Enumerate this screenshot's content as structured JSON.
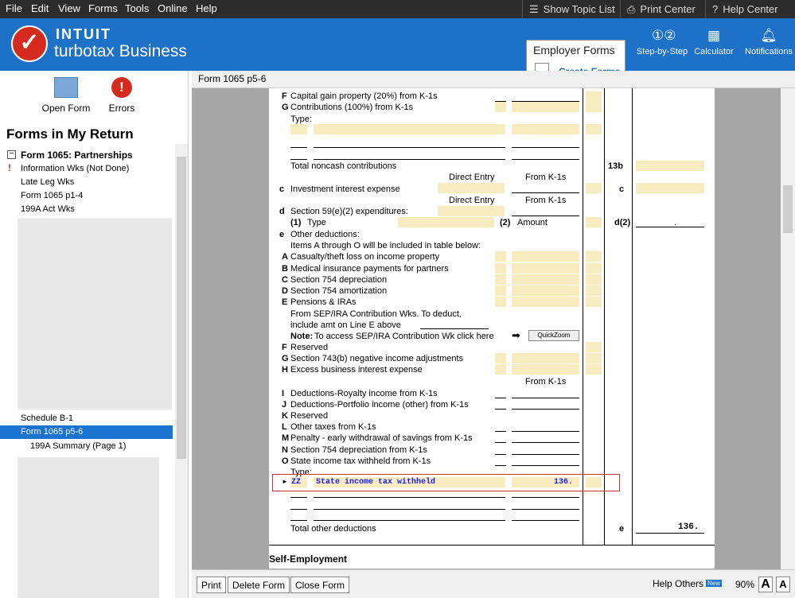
{
  "menu": {
    "items": [
      "File",
      "Edit",
      "View",
      "Forms",
      "Tools",
      "Online",
      "Help"
    ],
    "show_topic_list": "Show Topic List",
    "print_center": "Print Center",
    "help_center": "Help Center"
  },
  "brand": {
    "line1": "INTUIT",
    "line2": "turbotax Business"
  },
  "employer": {
    "title": "Employer Forms",
    "link": "Create Forms"
  },
  "header_buttons": {
    "step": "Step-by-Step",
    "calc": "Calculator",
    "notif": "Notifications"
  },
  "sidebar": {
    "open_form": "Open Form",
    "errors": "Errors",
    "title": "Forms in My Return",
    "group": "Form 1065:  Partnerships",
    "items": [
      "Information Wks (Not Done)",
      "Late Leg Wks",
      "Form 1065 p1-4",
      "199A Act Wks"
    ],
    "items2": [
      "Schedule B-1",
      "Form 1065 p5-6",
      "199A Summary (Page 1)"
    ]
  },
  "main": {
    "title": "Form 1065 p5-6"
  },
  "form": {
    "f": "F",
    "f_text": "Capital gain property (20%) from K-1s",
    "g": "G",
    "g_text": "Contributions (100%) from K-1s",
    "type": "Type:",
    "total_noncash": "Total noncash contributions",
    "l13b": "13b",
    "direct_entry": "Direct Entry",
    "from_k1": "From K-1s",
    "c": "c",
    "c_text": "Investment interest expense",
    "d": "d",
    "d_text": "Section 59(e)(2) expenditures:",
    "d1": "(1)",
    "d1_text": "Type",
    "d2": "(2)",
    "d2_text": "Amount",
    "d2_line": "d(2)",
    "dot": ".",
    "e": "e",
    "e_text": "Other deductions:",
    "items_note": "Items A through O will be included in table below:",
    "A": "A",
    "A_text": "Casualty/theft loss on income property",
    "B": "B",
    "B_text": "Medical insurance payments for partners",
    "C": "C",
    "C_text": "Section 754 depreciation",
    "D": "D",
    "D_text": "Section 754 amortization",
    "E": "E",
    "E_text": "Pensions & IRAs",
    "sep1": "From SEP/IRA Contribution Wks.  To deduct,",
    "sep2": "include amt on Line E above",
    "note_bold": "Note:",
    "note_text": "To access SEP/IRA Contribution Wk click here",
    "quickzoom": "QuickZoom",
    "F2": "F",
    "F2_text": "Reserved",
    "G2": "G",
    "G2_text": "Section 743(b) negative income adjustments",
    "H": "H",
    "H_text": "Excess business interest expense",
    "from_k1_2": "From K-1s",
    "I": "I",
    "I_text": "Deductions-Royalty income from K-1s",
    "J": "J",
    "J_text": "Deductions-Portfolio income (other) from K-1s",
    "K": "K",
    "K_text": "Reserved",
    "L": "L",
    "L_text": "Other taxes from K-1s",
    "M": "M",
    "M_text": "Penalty - early withdrawal of savings from K-1s",
    "N": "N",
    "N_text": "Section 754 depreciation from K-1s",
    "O": "O",
    "O_text": "State income tax withheld from K-1s",
    "type2": "Type:",
    "zz_code": "ZZ",
    "zz_desc": "State income tax withheld",
    "zz_amount": "136.",
    "total_other": "Total other deductions",
    "e_line": "e",
    "total_amount": "136.",
    "self_emp": "Self-Employment"
  },
  "bottom": {
    "print": "Print",
    "delete": "Delete Form",
    "close": "Close Form",
    "help_others": "Help Others",
    "new_badge": "New",
    "zoom": "90%",
    "font_a": "A"
  }
}
